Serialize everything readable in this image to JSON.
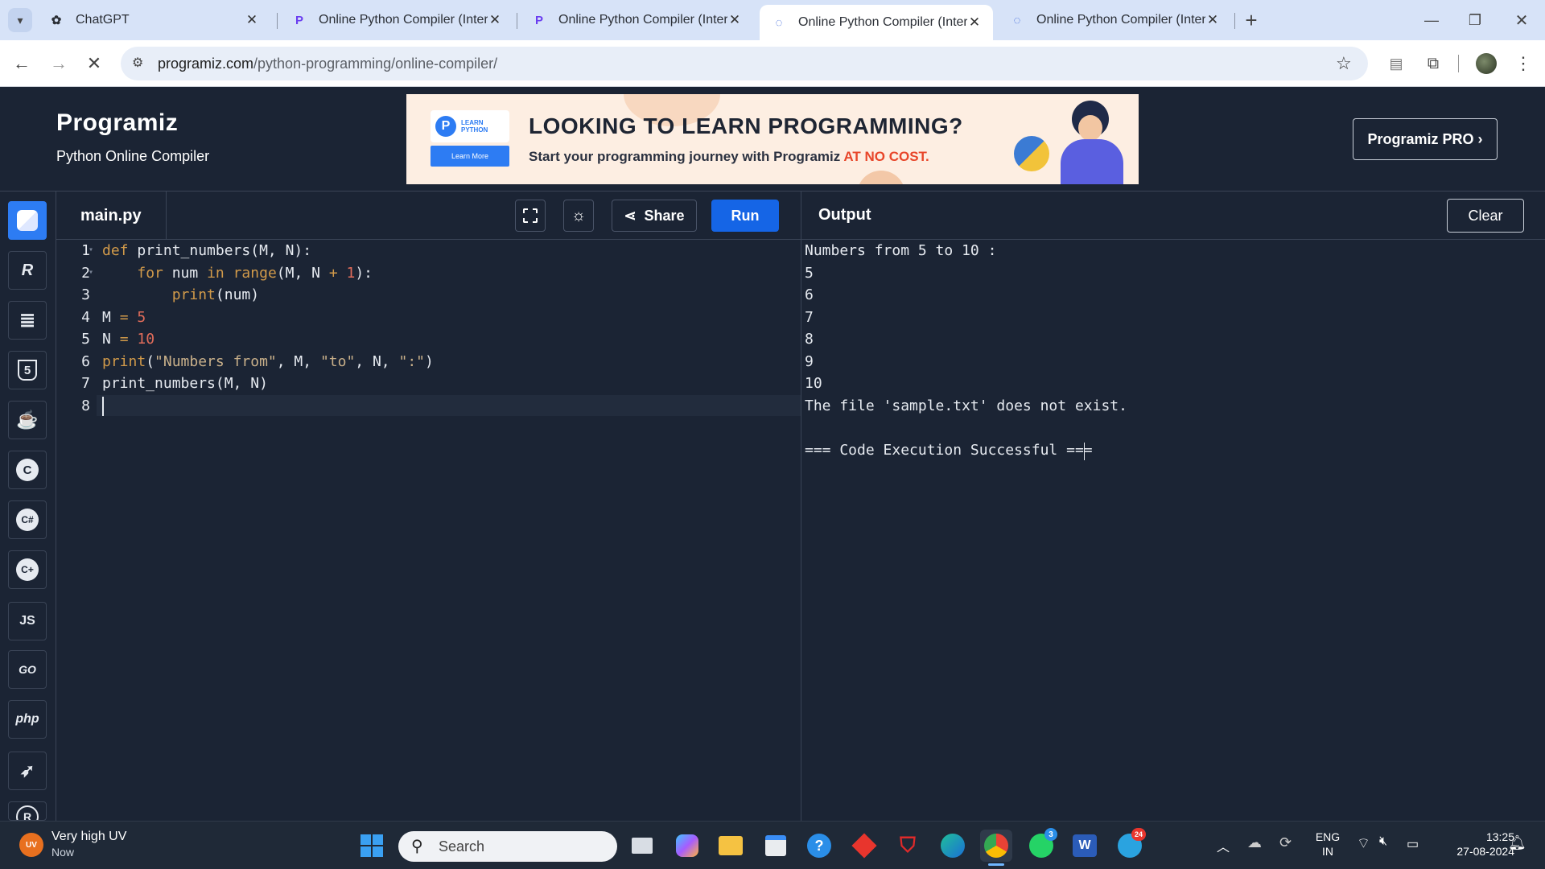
{
  "browser": {
    "tabs": [
      {
        "title": "ChatGPT",
        "favicon": "chatgpt-icon"
      },
      {
        "title": "Online Python Compiler (Interp",
        "favicon": "programiz-icon"
      },
      {
        "title": "Online Python Compiler (Interp",
        "favicon": "programiz-icon"
      },
      {
        "title": "Online Python Compiler (Interp",
        "favicon": "loading-icon",
        "active": true
      },
      {
        "title": "Online Python Compiler (Interp",
        "favicon": "programiz-icon"
      }
    ],
    "url_host": "programiz.com",
    "url_path": "/python-programming/online-compiler/"
  },
  "header": {
    "logo": "Programiz",
    "subtitle": "Python Online Compiler",
    "pro_button": "Programiz PRO ›",
    "banner": {
      "badge_top": "LEARN",
      "badge_bottom": "PYTHON",
      "learn_more": "Learn More",
      "headline": "LOOKING TO LEARN PROGRAMMING?",
      "tagline": "Start your programming journey with Programiz",
      "tagline_emph": "AT NO COST."
    }
  },
  "sidebar": {
    "items": [
      {
        "name": "python",
        "label": "",
        "active": true
      },
      {
        "name": "r",
        "label": "R"
      },
      {
        "name": "sql",
        "label": ""
      },
      {
        "name": "html",
        "label": "5"
      },
      {
        "name": "java",
        "label": ""
      },
      {
        "name": "c",
        "label": "C"
      },
      {
        "name": "csharp",
        "label": "C#"
      },
      {
        "name": "cpp",
        "label": "C+"
      },
      {
        "name": "js",
        "label": "JS"
      },
      {
        "name": "go",
        "label": "GO"
      },
      {
        "name": "php",
        "label": "php"
      },
      {
        "name": "swift",
        "label": ""
      },
      {
        "name": "rust",
        "label": "R"
      }
    ]
  },
  "editor": {
    "filename": "main.py",
    "share_label": "Share",
    "run_label": "Run",
    "line_numbers": [
      "1",
      "2",
      "3",
      "4",
      "5",
      "6",
      "7",
      "8"
    ]
  },
  "output": {
    "title": "Output",
    "clear_label": "Clear",
    "lines": [
      "Numbers from 5 to 10 :",
      "5",
      "6",
      "7",
      "8",
      "9",
      "10",
      "The file 'sample.txt' does not exist.",
      "",
      "=== Code Execution Successful ==="
    ]
  },
  "taskbar": {
    "weather_title": "Very high UV",
    "weather_sub": "Now",
    "weather_badge": "UV",
    "search_placeholder": "Search",
    "whatsapp_badge": "3",
    "telegram_badge": "24",
    "lang_top": "ENG",
    "lang_bottom": "IN",
    "time": "13:25",
    "date": "27-08-2024"
  },
  "colors": {
    "page_bg": "#1b2434",
    "run_button": "#1565e6",
    "sidebar_active": "#2d7cf3",
    "keyword": "#d19a4a",
    "number": "#e06c5a",
    "string": "#c9b08a"
  }
}
